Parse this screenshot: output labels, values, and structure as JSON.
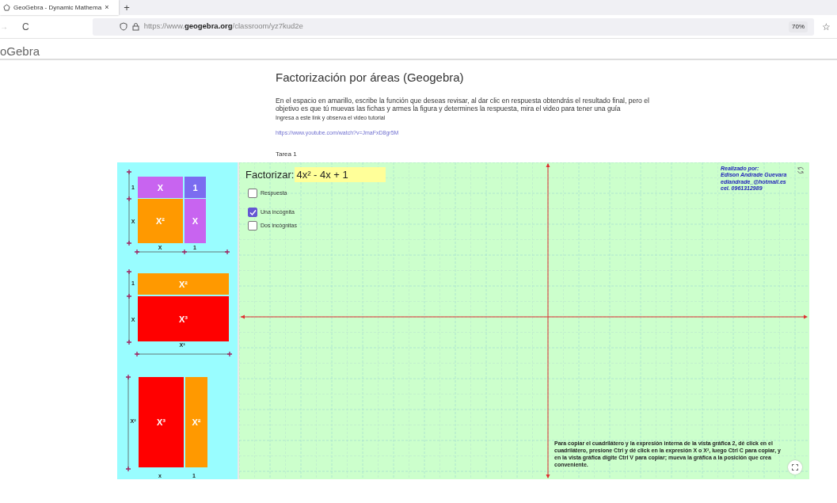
{
  "browser": {
    "tab_title": "GeoGebra - Dynamic Mathema",
    "tab_close": "×",
    "new_tab": "+",
    "back": "→",
    "reload": "C",
    "url": "https://www.**geogebra.org**/classroom/yz7kud2e",
    "zoom": "70%",
    "bookmark": "☆"
  },
  "site": {
    "logo": "oGebra"
  },
  "page": {
    "title": "Factorización por áreas (Geogebra)",
    "intro": "En el espacio en amarillo, escribe la función que deseas revisar, al dar clic en respuesta obtendrás el resultado final, pero el objetivo es que tú muevas las fichas y armes la figura y determines la respuesta, mira el video para tener una guía",
    "link_hint": "Ingresa a este link y observa el video tutorial",
    "link": "https://www.youtube.com/watch?v=JmaFxD8gr5M",
    "task": "Tarea 1"
  },
  "applet": {
    "tile_groups": [
      {
        "tiles": [
          {
            "label": "X",
            "color": "#c864f0"
          },
          {
            "label": "1",
            "color": "#7b6cf0"
          },
          {
            "label": "X²",
            "color": "#ff9900"
          },
          {
            "label": "X",
            "color": "#c864f0"
          }
        ],
        "side_labels": [
          "1",
          "X"
        ],
        "bottom_labels": [
          "X",
          "1"
        ]
      },
      {
        "tiles": [
          {
            "label": "X²",
            "color": "#ff9900"
          },
          {
            "label": "X³",
            "color": "#ff0000"
          }
        ],
        "side_labels": [
          "1",
          "X"
        ],
        "bottom_labels": [
          "X³"
        ]
      },
      {
        "tiles": [
          {
            "label": "X³",
            "color": "#ff0000"
          },
          {
            "label": "X²",
            "color": "#ff9900"
          }
        ],
        "side_labels": [
          "X²"
        ],
        "bottom_labels": [
          "x",
          "1"
        ]
      }
    ],
    "factor_label": "Factorizar:",
    "expression": "4x² - 4x + 1",
    "checkboxes": [
      {
        "label": "Respuesta",
        "checked": false
      },
      {
        "label": "Una incógnita",
        "checked": true
      },
      {
        "label": "Dos incógnitas",
        "checked": false
      }
    ],
    "credits": [
      "Realizado por:",
      "Edison Andrade Guevara",
      "ediandrade_@hotmail.es",
      "cel. 0961312989"
    ],
    "note": "Para copiar el cuadrilátero y la expresión interna de la vista gráfica 2, dé click en el cuadrilátero, presione Ctrl y dé click en la expresión X o X², luego Ctrl C para copiar, y en la vista gráfica digite Ctrl V para copiar; mueva la gráfica a la posición que crea conveniente."
  }
}
